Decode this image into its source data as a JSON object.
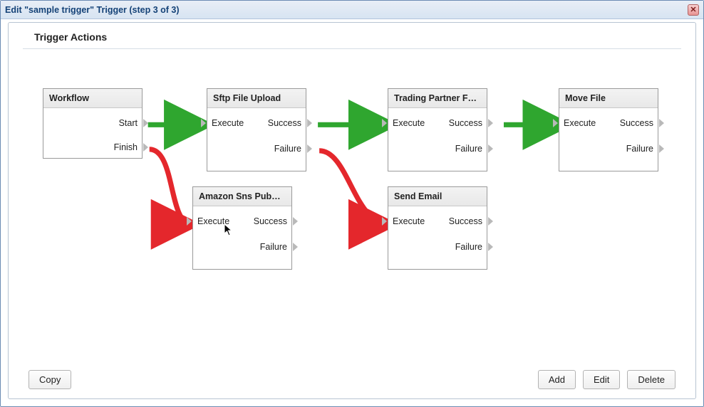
{
  "window": {
    "title": "Edit \"sample trigger\" Trigger (step 3 of 3)"
  },
  "section": {
    "title": "Trigger Actions"
  },
  "nodes": {
    "workflow": {
      "title": "Workflow",
      "start": "Start",
      "finish": "Finish"
    },
    "sftp": {
      "title": "Sftp File Upload",
      "execute": "Execute",
      "success": "Success",
      "failure": "Failure"
    },
    "trading": {
      "title": "Trading Partner F…",
      "execute": "Execute",
      "success": "Success",
      "failure": "Failure"
    },
    "move": {
      "title": "Move File",
      "execute": "Execute",
      "success": "Success",
      "failure": "Failure"
    },
    "sns": {
      "title": "Amazon Sns Pub…",
      "execute": "Execute",
      "success": "Success",
      "failure": "Failure"
    },
    "email": {
      "title": "Send Email",
      "execute": "Execute",
      "success": "Success",
      "failure": "Failure"
    }
  },
  "footer": {
    "copy": "Copy",
    "add": "Add",
    "edit": "Edit",
    "delete": "Delete"
  },
  "colors": {
    "success_edge": "#2fa62f",
    "failure_edge": "#e4272c"
  },
  "chart_data": {
    "type": "diagram",
    "title": "Trigger Actions",
    "nodes": [
      {
        "id": "workflow",
        "label": "Workflow",
        "ports_out": [
          "Start",
          "Finish"
        ],
        "ports_in": []
      },
      {
        "id": "sftp",
        "label": "Sftp File Upload",
        "ports_in": [
          "Execute"
        ],
        "ports_out": [
          "Success",
          "Failure"
        ]
      },
      {
        "id": "trading",
        "label": "Trading Partner F…",
        "ports_in": [
          "Execute"
        ],
        "ports_out": [
          "Success",
          "Failure"
        ]
      },
      {
        "id": "move",
        "label": "Move File",
        "ports_in": [
          "Execute"
        ],
        "ports_out": [
          "Success",
          "Failure"
        ]
      },
      {
        "id": "sns",
        "label": "Amazon Sns Pub…",
        "ports_in": [
          "Execute"
        ],
        "ports_out": [
          "Success",
          "Failure"
        ]
      },
      {
        "id": "email",
        "label": "Send Email",
        "ports_in": [
          "Execute"
        ],
        "ports_out": [
          "Success",
          "Failure"
        ]
      }
    ],
    "edges": [
      {
        "from": "workflow",
        "from_port": "Start",
        "to": "sftp",
        "to_port": "Execute",
        "kind": "success"
      },
      {
        "from": "sftp",
        "from_port": "Success",
        "to": "trading",
        "to_port": "Execute",
        "kind": "success"
      },
      {
        "from": "trading",
        "from_port": "Success",
        "to": "move",
        "to_port": "Execute",
        "kind": "success"
      },
      {
        "from": "workflow",
        "from_port": "Finish",
        "to": "sns",
        "to_port": "Execute",
        "kind": "failure"
      },
      {
        "from": "sftp",
        "from_port": "Failure",
        "to": "email",
        "to_port": "Execute",
        "kind": "failure"
      }
    ]
  }
}
